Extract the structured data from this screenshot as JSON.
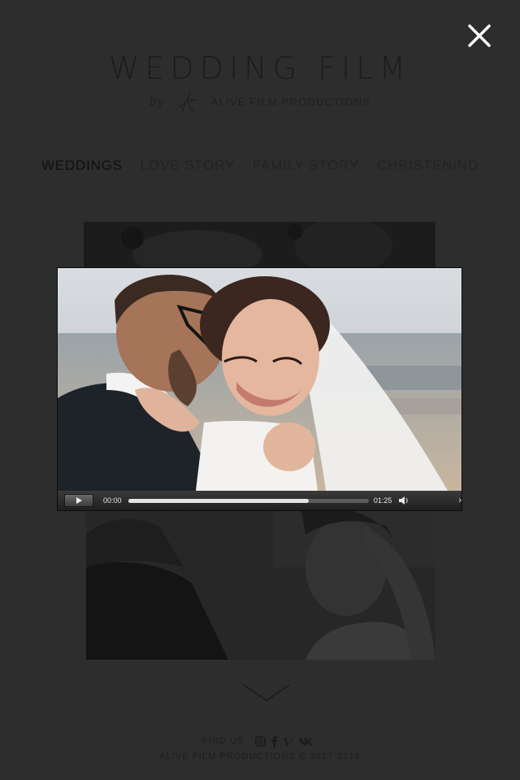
{
  "header": {
    "close_icon": "close-icon",
    "title": "WEDDING FILM",
    "by": "by",
    "company": "ALIVE FILM PRODUCTIONS"
  },
  "nav": {
    "items": [
      {
        "label": "WEDDINGS",
        "active": true
      },
      {
        "label": "LOVE STORY",
        "active": false
      },
      {
        "label": "FAMILY STORY",
        "active": false
      },
      {
        "label": "CHRISTENIND",
        "active": false
      }
    ]
  },
  "player": {
    "current_time": "00:00",
    "duration": "01:25",
    "buffered_fraction": 0.75,
    "play_icon": "play-icon",
    "volume_icon": "volume-icon",
    "more_label": "›"
  },
  "footer": {
    "find_us": "FIND US",
    "social_icons": [
      "instagram-icon",
      "facebook-icon",
      "vimeo-icon",
      "vk-icon"
    ],
    "copyright": "ALIVE FILM PRODUCTIONS © 2017-2018"
  },
  "colors": {
    "background": "#2d2d2d",
    "overlay_text": "#1c1c1c",
    "close_icon": "#ffffff"
  }
}
